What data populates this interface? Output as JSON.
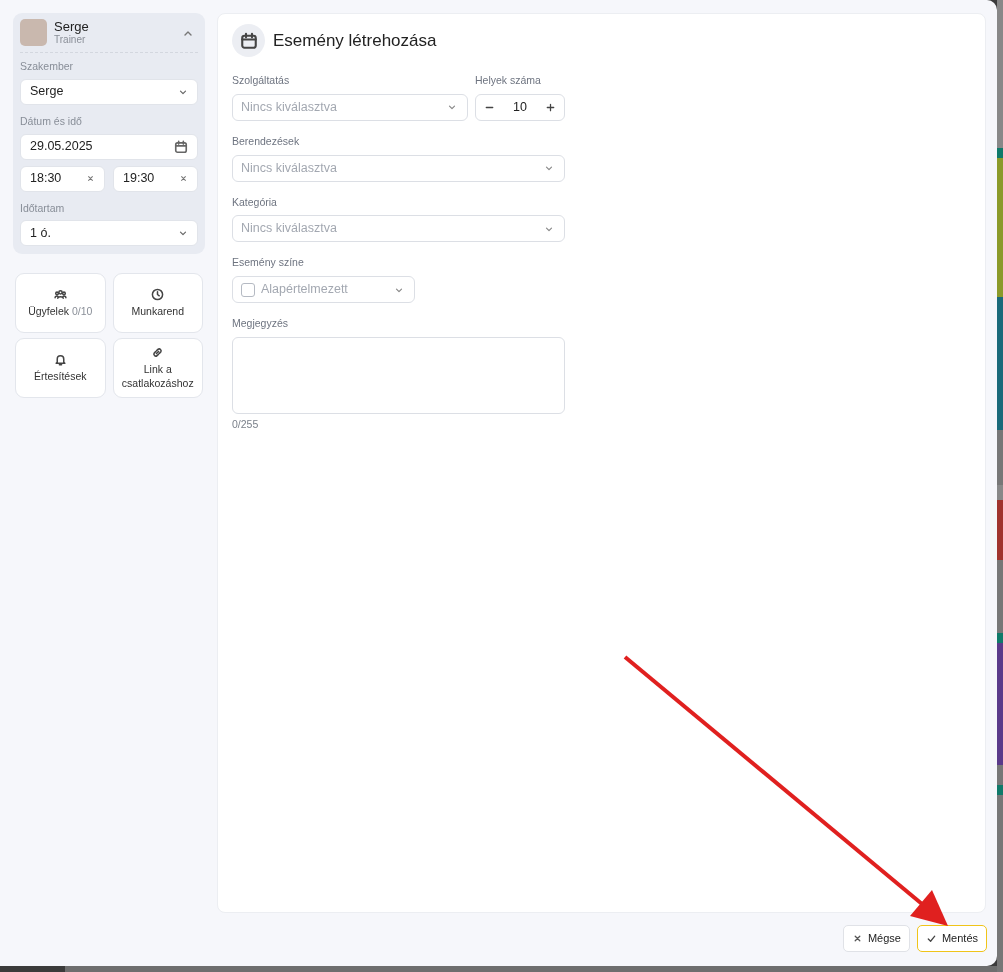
{
  "profile": {
    "name": "Serge",
    "role": "Trainer",
    "expanded": true
  },
  "sidebar_fields": [
    {
      "kind": "select",
      "label": "Szakember",
      "value": "Serge"
    },
    {
      "kind": "date",
      "label": "Dátum és idő",
      "value": "29.05.2025"
    },
    {
      "kind": "time_range",
      "from": "18:30",
      "to": "19:30"
    },
    {
      "kind": "select",
      "label": "Időtartam",
      "value": "1 ó."
    }
  ],
  "tiles": [
    {
      "kind": "people",
      "label": "Ügyfelek",
      "count": "0/10"
    },
    {
      "kind": "clock",
      "label": "Munkarend"
    },
    {
      "kind": "bell",
      "label": "Értesítések"
    },
    {
      "kind": "link",
      "label": "Link a csatlakozáshoz"
    }
  ],
  "form": {
    "title": "Esemény létrehozása",
    "fields": [
      {
        "kind": "select",
        "label": "Szolgáltatás",
        "placeholder": "Nincs kiválasztva"
      },
      {
        "kind": "stepper",
        "label": "Helyek száma",
        "value": "10"
      },
      {
        "kind": "select",
        "label": "Berendezések",
        "placeholder": "Nincs kiválasztva"
      },
      {
        "kind": "select",
        "label": "Kategória",
        "placeholder": "Nincs kiválasztva"
      },
      {
        "kind": "color_select",
        "label": "Esemény színe",
        "placeholder": "Alapértelmezett"
      },
      {
        "kind": "textarea",
        "label": "Megjegyzés",
        "counter": "0/255"
      }
    ]
  },
  "footer_buttons": [
    {
      "kind": "cancel",
      "label": "Mégse"
    },
    {
      "kind": "save",
      "label": "Mentés"
    }
  ]
}
